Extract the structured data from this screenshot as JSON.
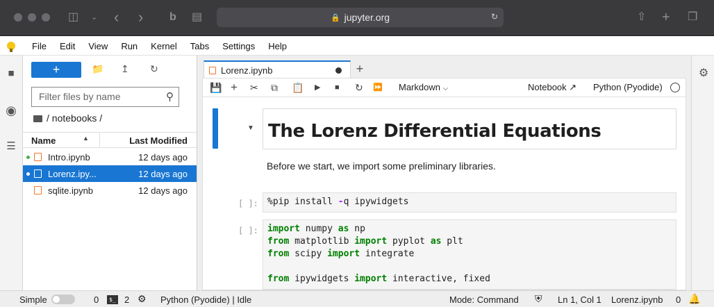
{
  "browser": {
    "url": "jupyter.org"
  },
  "menu": [
    "File",
    "Edit",
    "View",
    "Run",
    "Kernel",
    "Tabs",
    "Settings",
    "Help"
  ],
  "filebrowser": {
    "new_label": "+",
    "filter_placeholder": "Filter files by name",
    "breadcrumb": "/ notebooks /",
    "col_name": "Name",
    "col_modified": "Last Modified",
    "files": [
      {
        "name": "Intro.ipynb",
        "modified": "12 days ago"
      },
      {
        "name": "Lorenz.ipy...",
        "modified": "12 days ago"
      },
      {
        "name": "sqlite.ipynb",
        "modified": "12 days ago"
      }
    ]
  },
  "tab": {
    "title": "Lorenz.ipynb",
    "add": "+"
  },
  "toolbar": {
    "cell_type": "Markdown",
    "notebook_label": "Notebook",
    "kernel": "Python (Pyodide)"
  },
  "notebook": {
    "heading": "The Lorenz Differential Equations",
    "paragraph": "Before we start, we import some preliminary libraries.",
    "prompt1": "[ ]:",
    "prompt2": "[ ]:"
  },
  "status": {
    "mode_label": "Simple",
    "count1": "0",
    "count2": "2",
    "kernel": "Python (Pyodide) | Idle",
    "mode": "Mode: Command",
    "position": "Ln 1, Col 1",
    "file": "Lorenz.ipynb",
    "notif_count": "0"
  },
  "colors": {
    "accent": "#1976d2",
    "notebook_icon": "#f37626",
    "active_dot": "#4caf50"
  }
}
